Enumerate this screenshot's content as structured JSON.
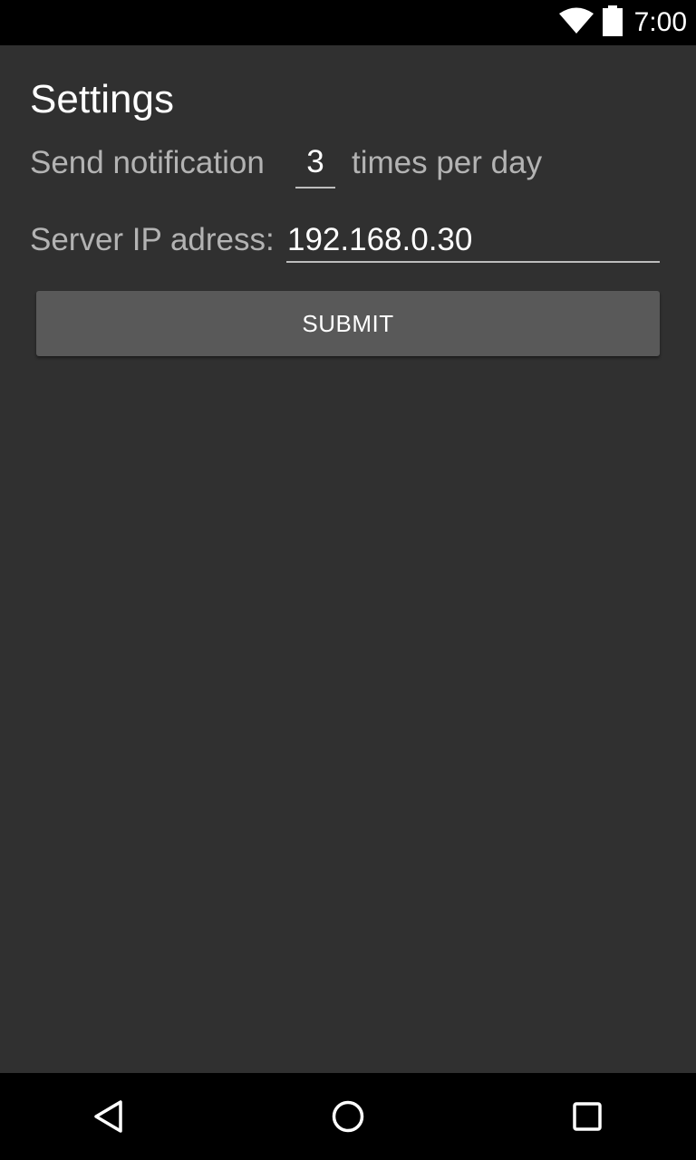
{
  "status_bar": {
    "time": "7:00",
    "icons": [
      "wifi-icon",
      "battery-icon"
    ]
  },
  "settings": {
    "title": "Settings",
    "send_label": "Send notification",
    "count_value": "3",
    "times_label": "times per day",
    "server_label": "Server IP adress:",
    "server_ip_value": "192.168.0.30",
    "submit_label": "SUBMIT"
  },
  "nav_bar": {
    "icons": [
      "back-icon",
      "home-icon",
      "recents-icon"
    ]
  },
  "colors": {
    "background": "#303030",
    "status_bar": "#000000",
    "label_text": "#b3b3b3",
    "value_text": "#ffffff",
    "button": "#595959"
  }
}
